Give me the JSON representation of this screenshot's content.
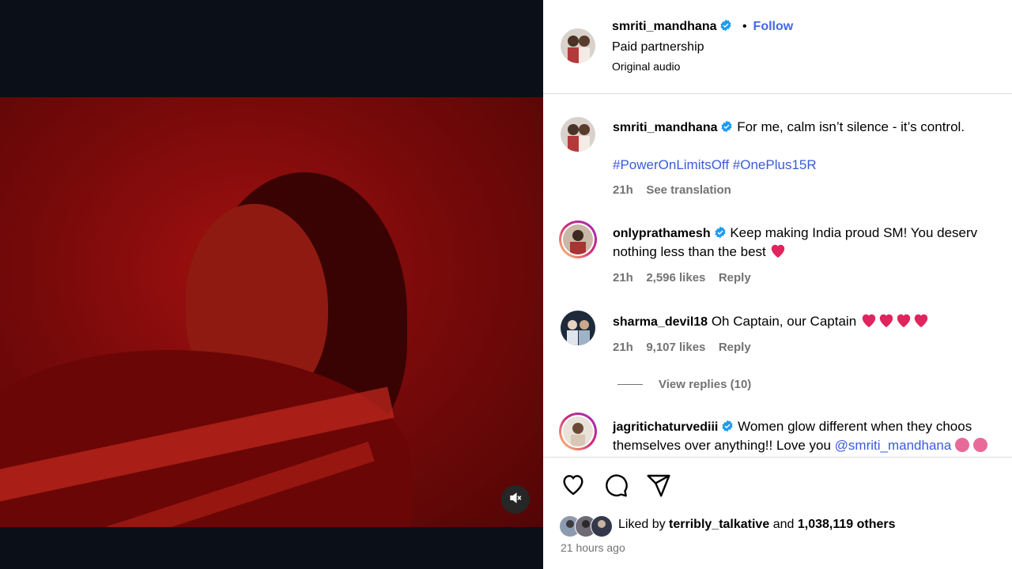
{
  "header": {
    "username": "smriti_mandhana",
    "dot": "•",
    "follow_label": "Follow",
    "paid_partnership": "Paid partnership",
    "audio": "Original audio"
  },
  "caption": {
    "username": "smriti_mandhana",
    "text": "For me, calm isn’t silence - it’s control.",
    "hashtags": "#PowerOnLimitsOff #OnePlus15R",
    "time": "21h",
    "see_translation": "See translation"
  },
  "comments": [
    {
      "username": "onlyprathamesh",
      "text_line1": "Keep making India proud SM! You deserv",
      "text_line2": "nothing less than the best",
      "time": "21h",
      "likes": "2,596 likes",
      "reply": "Reply"
    },
    {
      "username": "sharma_devil18",
      "text": "Oh Captain, our Captain",
      "time": "21h",
      "likes": "9,107 likes",
      "reply": "Reply",
      "view_replies": "View replies (10)"
    },
    {
      "username": "jagritichaturvediii",
      "text_line1": "Women glow different when they choos",
      "text_line2": "themselves over anything!! Love you",
      "mention": "@smriti_mandhana"
    }
  ],
  "footer": {
    "liked_by_prefix": "Liked by",
    "liked_by_user": "terribly_talkative",
    "and": "and",
    "others": "1,038,119 others",
    "time_ago": "21 hours ago"
  },
  "icons": {
    "like": "heart-icon",
    "comment": "comment-icon",
    "share": "share-icon",
    "mute": "mute-icon",
    "verified": "verified-badge-icon"
  },
  "colors": {
    "accent_link": "#3b5bdb",
    "verified": "#1d9bf0",
    "heart_red": "#e0245e",
    "video_red": "#8a0b0b"
  }
}
